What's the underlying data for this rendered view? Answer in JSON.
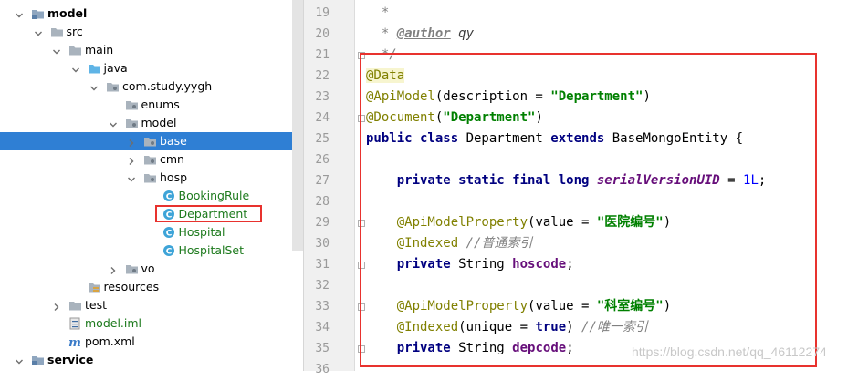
{
  "tree": {
    "items": [
      {
        "label": "model",
        "depth": 0,
        "expanded": true,
        "icon": "module-folder-icon",
        "bold": true
      },
      {
        "label": "src",
        "depth": 1,
        "expanded": true,
        "icon": "folder-icon"
      },
      {
        "label": "main",
        "depth": 2,
        "expanded": true,
        "icon": "folder-icon"
      },
      {
        "label": "java",
        "depth": 3,
        "expanded": true,
        "icon": "source-folder-icon"
      },
      {
        "label": "com.study.yygh",
        "depth": 4,
        "expanded": true,
        "icon": "package-icon"
      },
      {
        "label": "enums",
        "depth": 5,
        "icon": "package-icon"
      },
      {
        "label": "model",
        "depth": 5,
        "expanded": true,
        "icon": "package-icon"
      },
      {
        "label": "base",
        "depth": 6,
        "expanded": false,
        "icon": "package-icon",
        "selected": true
      },
      {
        "label": "cmn",
        "depth": 6,
        "expanded": false,
        "icon": "package-icon"
      },
      {
        "label": "hosp",
        "depth": 6,
        "expanded": true,
        "icon": "package-icon"
      },
      {
        "label": "BookingRule",
        "depth": 7,
        "icon": "class-icon",
        "class": true
      },
      {
        "label": "Department",
        "depth": 7,
        "icon": "class-icon",
        "class": true,
        "highlight": true
      },
      {
        "label": "Hospital",
        "depth": 7,
        "icon": "class-icon",
        "class": true
      },
      {
        "label": "HospitalSet",
        "depth": 7,
        "icon": "class-icon",
        "class": true
      },
      {
        "label": "vo",
        "depth": 5,
        "expanded": false,
        "icon": "package-icon"
      },
      {
        "label": "resources",
        "depth": 3,
        "icon": "resources-folder-icon"
      },
      {
        "label": "test",
        "depth": 2,
        "expanded": false,
        "icon": "folder-icon"
      },
      {
        "label": "model.iml",
        "depth": 2,
        "icon": "iml-file-icon",
        "class": true
      },
      {
        "label": "pom.xml",
        "depth": 2,
        "icon": "maven-icon"
      },
      {
        "label": "service",
        "depth": 0,
        "expanded": true,
        "icon": "module-folder-icon",
        "bold": true
      }
    ]
  },
  "editor": {
    "lines": [
      {
        "n": "19",
        "tokens": [
          [
            "cm",
            "  *"
          ]
        ]
      },
      {
        "n": "20",
        "tokens": [
          [
            "cm",
            "  * "
          ],
          [
            "tag",
            "@author"
          ],
          [
            "tagv",
            " qy"
          ]
        ]
      },
      {
        "n": "21",
        "tokens": [
          [
            "cm",
            "  */"
          ]
        ],
        "fold": true
      },
      {
        "n": "22",
        "tokens": [
          [
            "anno",
            "@Data"
          ]
        ]
      },
      {
        "n": "23",
        "tokens": [
          [
            "anno2",
            "@ApiModel"
          ],
          [
            "p",
            "(description = "
          ],
          [
            "str",
            "\"Department\""
          ],
          [
            "p",
            ")"
          ]
        ]
      },
      {
        "n": "24",
        "tokens": [
          [
            "anno2",
            "@Document"
          ],
          [
            "p",
            "("
          ],
          [
            "str",
            "\"Department\""
          ],
          [
            "p",
            ")"
          ]
        ],
        "fold": true
      },
      {
        "n": "25",
        "tokens": [
          [
            "kw",
            "public class "
          ],
          [
            "p",
            "Department "
          ],
          [
            "kw",
            "extends "
          ],
          [
            "p",
            "BaseMongoEntity {"
          ]
        ]
      },
      {
        "n": "26",
        "tokens": []
      },
      {
        "n": "27",
        "tokens": [
          [
            "p",
            "    "
          ],
          [
            "kw",
            "private static final long "
          ],
          [
            "sf",
            "serialVersionUID"
          ],
          [
            "p",
            " = "
          ],
          [
            "num",
            "1L"
          ],
          [
            "p",
            ";"
          ]
        ]
      },
      {
        "n": "28",
        "tokens": []
      },
      {
        "n": "29",
        "tokens": [
          [
            "p",
            "    "
          ],
          [
            "anno2",
            "@ApiModelProperty"
          ],
          [
            "p",
            "(value = "
          ],
          [
            "str",
            "\"医院编号\""
          ],
          [
            "p",
            ")"
          ]
        ],
        "fold": true
      },
      {
        "n": "30",
        "tokens": [
          [
            "p",
            "    "
          ],
          [
            "anno2",
            "@Indexed "
          ],
          [
            "cm",
            "//普通索引"
          ]
        ]
      },
      {
        "n": "31",
        "tokens": [
          [
            "p",
            "    "
          ],
          [
            "kw",
            "private "
          ],
          [
            "p",
            "String "
          ],
          [
            "fld",
            "hoscode"
          ],
          [
            "p",
            ";"
          ]
        ],
        "fold": true
      },
      {
        "n": "32",
        "tokens": []
      },
      {
        "n": "33",
        "tokens": [
          [
            "p",
            "    "
          ],
          [
            "anno2",
            "@ApiModelProperty"
          ],
          [
            "p",
            "(value = "
          ],
          [
            "str",
            "\"科室编号\""
          ],
          [
            "p",
            ")"
          ]
        ],
        "fold": true
      },
      {
        "n": "34",
        "tokens": [
          [
            "p",
            "    "
          ],
          [
            "anno2",
            "@Indexed"
          ],
          [
            "p",
            "(unique = "
          ],
          [
            "kw",
            "true"
          ],
          [
            "p",
            ") "
          ],
          [
            "cm",
            "//唯一索引"
          ]
        ]
      },
      {
        "n": "35",
        "tokens": [
          [
            "p",
            "    "
          ],
          [
            "kw",
            "private "
          ],
          [
            "p",
            "String "
          ],
          [
            "fld",
            "depcode"
          ],
          [
            "p",
            ";"
          ]
        ],
        "fold": true
      },
      {
        "n": "36",
        "tokens": []
      }
    ]
  },
  "watermark": "https://blog.csdn.net/qq_46112274",
  "colors": {
    "selection": "#2f7fd4",
    "highlight_box": "#e8322e",
    "class_label": "#1d7a1d"
  }
}
